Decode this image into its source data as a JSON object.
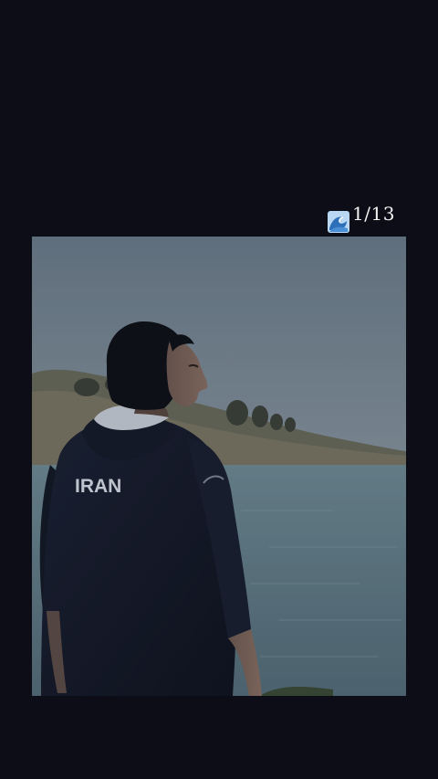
{
  "story": {
    "emoji": "water-wave-icon",
    "counter": "1/13"
  },
  "photo": {
    "jacket_text": "IRAN"
  }
}
